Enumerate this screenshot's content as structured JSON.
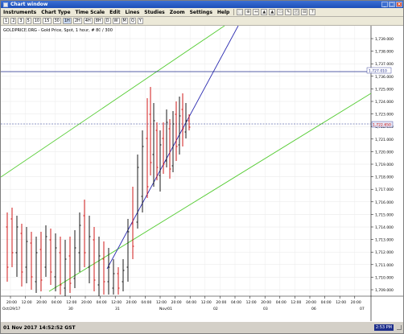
{
  "window": {
    "title": "Chart window"
  },
  "menu": [
    "Instruments",
    "Chart Type",
    "Time Scale",
    "Edit",
    "Lines",
    "Studies",
    "Zoom",
    "Settings",
    "Help"
  ],
  "tools": [
    "⬚",
    "⊕",
    "↔",
    "▲",
    "▲",
    "▭",
    "✎",
    "◰",
    "⊟",
    "?"
  ],
  "timeframes": [
    "1",
    "2",
    "3",
    "5",
    "10",
    "15",
    "30",
    "1H",
    "2H",
    "4H",
    "8H",
    "D",
    "W",
    "M",
    "Q",
    "Y"
  ],
  "timeframe_active": "1H",
  "header_label": "GOLDPRICE.ORG - Gold Price, Spot, 1 hour, # 80 / 300",
  "colors": {
    "background": "#ffffff",
    "candle_up": "#000000",
    "candle_down": "#cc0000",
    "channel": "#55cc33",
    "trendline": "#2a2ab0",
    "level": "#1f2a8a",
    "price_line": "#1f2a8a"
  },
  "chart_data": {
    "type": "candlestick",
    "y_ticks": [
      "1,739.000",
      "1,738.000",
      "1,737.000",
      "1,736.000",
      "1,725.000",
      "1,724.000",
      "1,723.000",
      "1,722.000",
      "1,721.000",
      "1,720.000",
      "1,719.000",
      "1,718.000",
      "1,717.000",
      "1,716.000",
      "1,715.000",
      "1,714.000",
      "1,713.000",
      "1,712.000",
      "1,711.000",
      "1,710.000",
      "1,709.000"
    ],
    "x_ticks_top": [
      "20:00",
      "12:00",
      "20:00",
      "04:00",
      "12:00",
      "20:00",
      "04:00",
      "12:00",
      "20:00",
      "04:00",
      "12:00",
      "20:00",
      "04:00",
      "12:00",
      "20:00",
      "04:00",
      "12:00",
      "20:00",
      "04:00",
      "12:00",
      "20:00",
      "04:00",
      "12:00",
      "20:00",
      "04:00"
    ],
    "x_ticks_bottom": [
      "Oct/29/17",
      "30",
      "31",
      "Nov/01",
      "02",
      "03",
      "06",
      "07"
    ],
    "level_label": "1,727.010",
    "current_price_label": "1,722.650",
    "status_datetime": "01 Nov 2017 14:52:52 GST",
    "status_clock": "2:53 PM"
  }
}
